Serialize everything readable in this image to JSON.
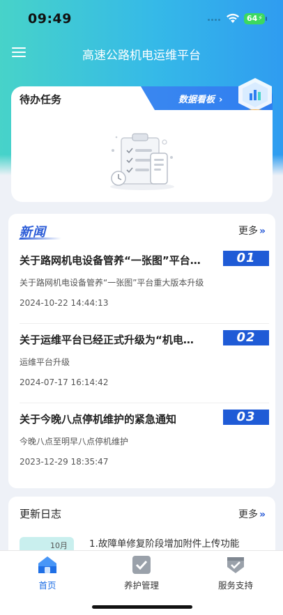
{
  "status_bar": {
    "time": "09:49",
    "battery": "64"
  },
  "nav": {
    "title": "高速公路机电运维平台",
    "menu_icon": "hamburger-menu-icon"
  },
  "todo": {
    "title": "待办任务",
    "dashboard_link": "数据看板",
    "dashboard_chevron": "›",
    "empty_icon": "clipboard-checklist-empty-icon"
  },
  "news": {
    "title": "新闻",
    "more": "更多",
    "more_arrows": "»",
    "items": [
      {
        "badge": "01",
        "title": "关于路网机电设备管养“一张图”平台…",
        "desc": "关于路网机电设备管养“一张图”平台重大版本升级",
        "date": "2024-10-22 14:44:13"
      },
      {
        "badge": "02",
        "title": "关于运维平台已经正式升级为“机电…",
        "desc": "运维平台升级",
        "date": "2024-07-17 16:14:42"
      },
      {
        "badge": "03",
        "title": "关于今晚八点停机维护的紧急通知",
        "desc": "今晚八点至明早八点停机维护",
        "date": "2023-12-29 18:35:47"
      }
    ]
  },
  "update_log": {
    "title": "更新日志",
    "more": "更多",
    "more_arrows": "»",
    "month": "10月",
    "entry": "1.故障单修复阶段增加附件上传功能"
  },
  "tabs": [
    {
      "label": "首页",
      "icon": "home-icon",
      "active": true,
      "color": "#1f6fe5"
    },
    {
      "label": "养护管理",
      "icon": "checkbox-icon",
      "active": false,
      "color": "#9aa1aa"
    },
    {
      "label": "服务支持",
      "icon": "support-shield-icon",
      "active": false,
      "color": "#9aa1aa"
    }
  ]
}
